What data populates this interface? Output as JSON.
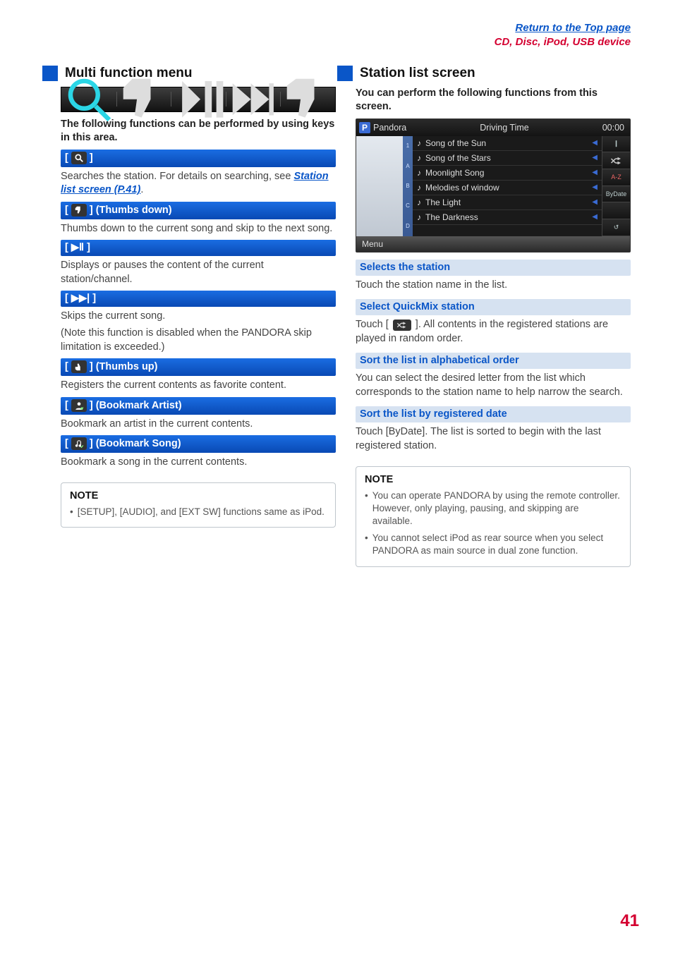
{
  "header": {
    "top_link": "Return to the Top page",
    "breadcrumb": "CD, Disc, iPod, USB device"
  },
  "left": {
    "title": "Multi function menu",
    "intro": "The following functions can be performed by using keys in this area.",
    "search": {
      "bracket_open": "[ ",
      "bracket_close": " ]",
      "desc_pre": "Searches the station. For details on searching, see ",
      "link": "Station list screen (P.41)",
      "desc_post": "."
    },
    "thumbs_down": {
      "label_pre": "[ ",
      "label_post": " ] (Thumbs down)",
      "desc": "Thumbs down to the current song and skip to the next song."
    },
    "playpause": {
      "label": "[ ▶Ⅱ ]",
      "desc": "Displays or pauses the content of the current station/channel."
    },
    "skip": {
      "label": "[ ▶▶| ]",
      "desc1": "Skips the current song.",
      "desc2": "(Note this function is disabled when the PANDORA skip limitation is exceeded.)"
    },
    "thumbs_up": {
      "label_pre": "[ ",
      "label_post": " ] (Thumbs up)",
      "desc": "Registers the current contents as favorite content."
    },
    "bm_artist": {
      "label_pre": "[ ",
      "label_post": " ] (Bookmark Artist)",
      "desc": "Bookmark an artist in the current contents."
    },
    "bm_song": {
      "label_pre": "[ ",
      "label_post": " ] (Bookmark Song)",
      "desc": "Bookmark a song in the current contents."
    },
    "note": {
      "title": "NOTE",
      "item": "[SETUP], [AUDIO], and [EXT SW] functions same as iPod."
    }
  },
  "right": {
    "title": "Station list screen",
    "intro": "You can perform the following functions from this screen.",
    "device": {
      "badge": "P",
      "service": "Pandora",
      "now": "Driving Time",
      "time": "00:00",
      "scroll": [
        "1",
        "A",
        "B",
        "C",
        "D"
      ],
      "songs": [
        "Song of the Sun",
        "Song of the Stars",
        "Moonlight Song",
        "Melodies of window",
        "The Light",
        "The Darkness"
      ],
      "right_buttons": [
        "❙",
        "✕",
        "A-Z",
        "ByDate",
        "",
        "↺"
      ],
      "menu": "Menu"
    },
    "selects": {
      "title": "Selects the station",
      "desc": "Touch the station name in the list."
    },
    "quickmix": {
      "title": "Select QuickMix station",
      "desc_pre": "Touch [ ",
      "desc_post": " ]. All contents in the registered stations are played in random order."
    },
    "alpha": {
      "title": "Sort the list in alphabetical order",
      "desc": "You can select the desired letter from the list which corresponds to the station name to help narrow the search."
    },
    "bydate": {
      "title": "Sort the list by registered date",
      "desc": "Touch [ByDate]. The list is sorted to begin with the last registered station."
    },
    "note": {
      "title": "NOTE",
      "items": [
        "You can operate PANDORA by using the remote controller. However, only playing, pausing, and skipping are available.",
        "You cannot select iPod as rear source when you select PANDORA as main source in dual zone function."
      ]
    }
  },
  "page_number": "41"
}
